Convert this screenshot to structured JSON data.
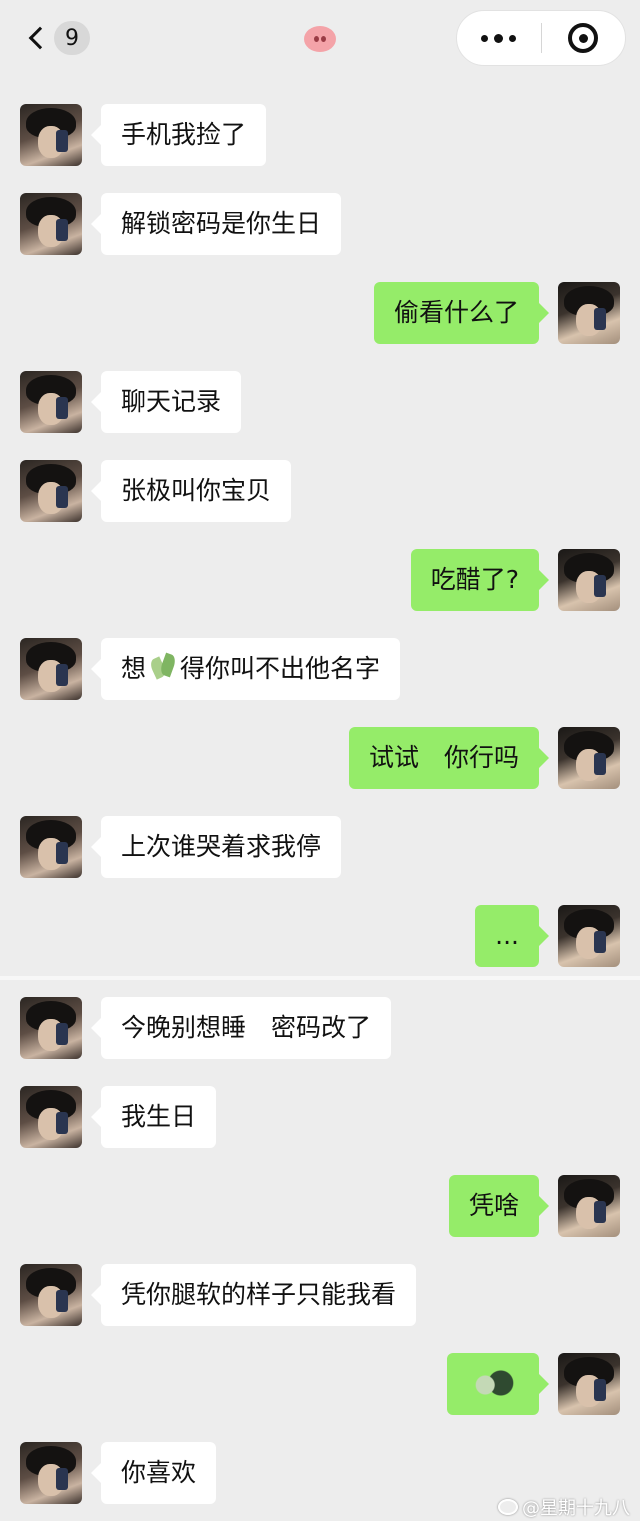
{
  "header": {
    "back_badge": "9",
    "title_icon": "pig-nose-icon",
    "capsule": {
      "more_icon": "more-dots-icon",
      "close_icon": "target-close-icon"
    }
  },
  "messages": [
    {
      "side": "left",
      "text": "手机我捡了"
    },
    {
      "side": "left",
      "text": "解锁密码是你生日"
    },
    {
      "side": "right",
      "text": "偷看什么了"
    },
    {
      "side": "left",
      "text": "聊天记录"
    },
    {
      "side": "left",
      "text": "张极叫你宝贝"
    },
    {
      "side": "right",
      "text": "吃醋了?"
    },
    {
      "side": "left",
      "text_before": "想",
      "text_after": "得你叫不出他名字",
      "inline_sticker": "leaf-sticker-icon"
    },
    {
      "side": "right",
      "text": "试试　你行吗"
    },
    {
      "side": "left",
      "text": "上次谁哭着求我停"
    },
    {
      "side": "right",
      "text": "..."
    },
    {
      "side": "left",
      "text": "今晚别想睡　密码改了"
    },
    {
      "side": "left",
      "text": "我生日"
    },
    {
      "side": "right",
      "text": "凭啥"
    },
    {
      "side": "left",
      "text": "凭你腿软的样子只能我看"
    },
    {
      "side": "right",
      "sticker": "emoji-sticker-image"
    },
    {
      "side": "left",
      "text": "你喜欢"
    }
  ],
  "watermark": {
    "text": "@星期十九八",
    "icon": "weibo-icon"
  },
  "colors": {
    "background": "#ededed",
    "incoming_bubble": "#ffffff",
    "outgoing_bubble": "#95ec69"
  }
}
